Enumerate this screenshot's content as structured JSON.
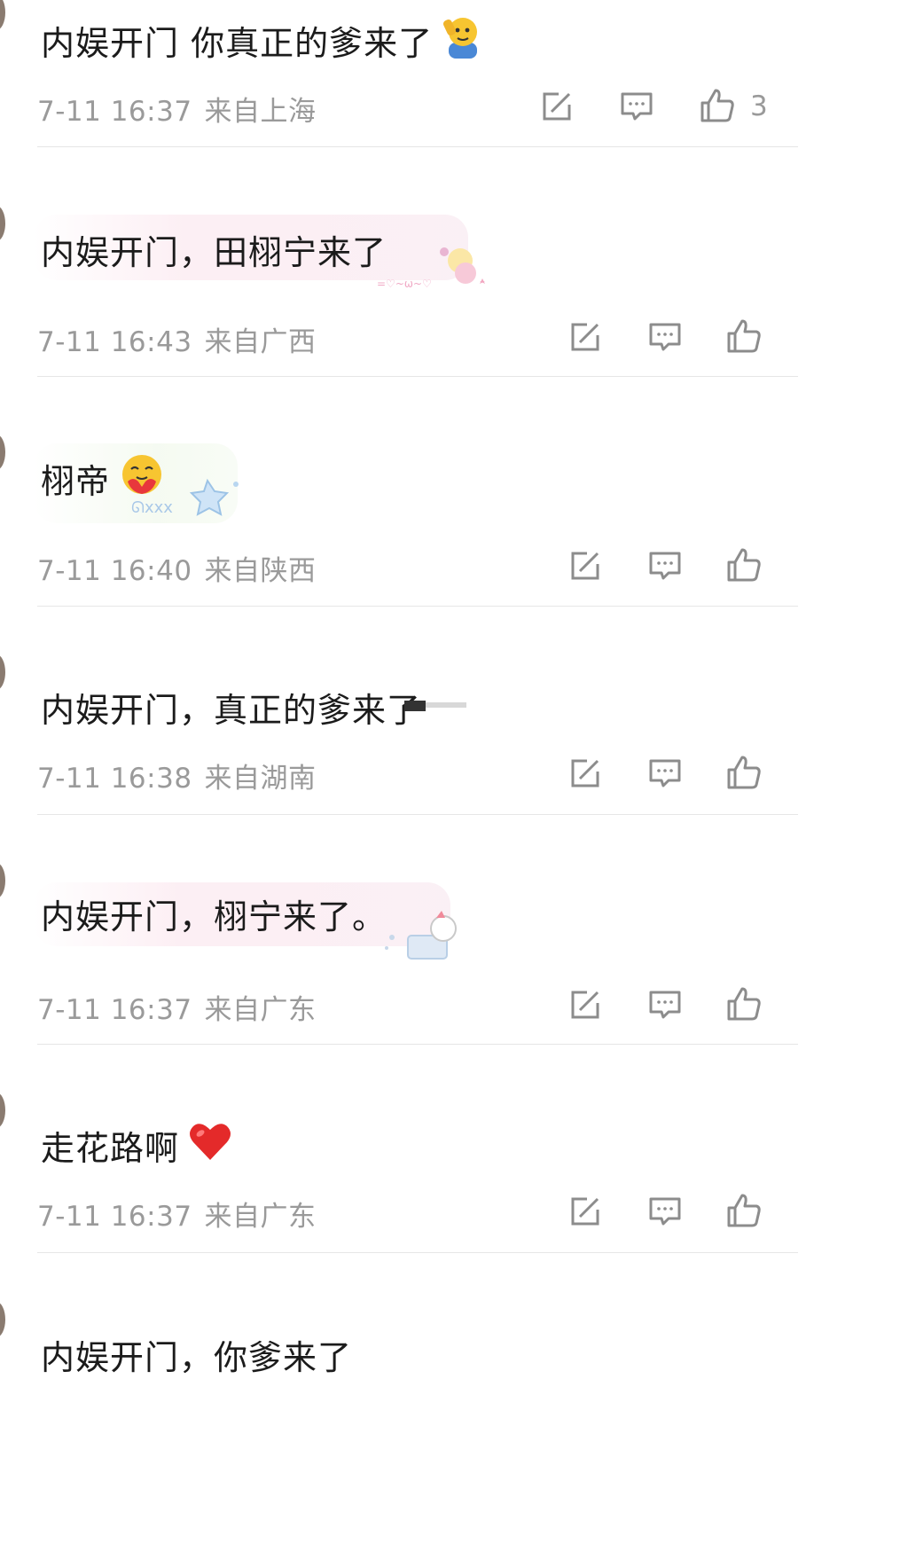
{
  "comments": [
    {
      "text": "内娱开门 你真正的爹来了",
      "emoji": "saluting-face-icon",
      "date": "7-11 16:37",
      "location": "来自上海",
      "likes": "3"
    },
    {
      "text": "内娱开门，田栩宁来了",
      "date": "7-11 16:43",
      "location": "来自广西",
      "likes": ""
    },
    {
      "text": "栩帝",
      "emoji": "hugging-face-icon",
      "date": "7-11 16:40",
      "location": "来自陕西",
      "likes": ""
    },
    {
      "text": "内娱开门，真正的爹来了",
      "date": "7-11 16:38",
      "location": "来自湖南",
      "likes": ""
    },
    {
      "text": "内娱开门，栩宁来了。",
      "date": "7-11 16:37",
      "location": "来自广东",
      "likes": ""
    },
    {
      "text": "走花路啊",
      "emoji": "red-heart-icon",
      "date": "7-11 16:37",
      "location": "来自广东",
      "likes": ""
    },
    {
      "text": "内娱开门，你爹来了"
    }
  ],
  "colors": {
    "text": "#1b1b1b",
    "meta": "#9a9a9a",
    "icon": "#8c8c8c",
    "divider": "#e6e6e6"
  }
}
